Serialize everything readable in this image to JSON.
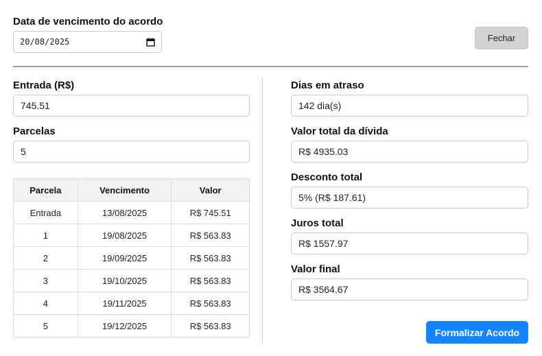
{
  "due_date": {
    "label": "Data de vencimento do acordo",
    "value": "20/08/2025"
  },
  "close_button": "Fechar",
  "left": {
    "entrada_label": "Entrada (R$)",
    "entrada_value": "745.51",
    "parcelas_label": "Parcelas",
    "parcelas_value": "5",
    "table": {
      "headers": [
        "Parcela",
        "Vencimento",
        "Valor"
      ],
      "rows": [
        [
          "Entrada",
          "13/08/2025",
          "R$ 745.51"
        ],
        [
          "1",
          "19/08/2025",
          "R$ 563.83"
        ],
        [
          "2",
          "19/09/2025",
          "R$ 563.83"
        ],
        [
          "3",
          "19/10/2025",
          "R$ 563.83"
        ],
        [
          "4",
          "19/11/2025",
          "R$ 563.83"
        ],
        [
          "5",
          "19/12/2025",
          "R$ 563.83"
        ]
      ]
    }
  },
  "right": {
    "dias_label": "Dias em atraso",
    "dias_value": "142 dia(s)",
    "total_label": "Valor total da dívida",
    "total_value": "R$ 4935.03",
    "desconto_label": "Desconto total",
    "desconto_value": "5% (R$ 187.61)",
    "juros_label": "Juros total",
    "juros_value": "R$ 1557.97",
    "final_label": "Valor final",
    "final_value": "R$ 3564.67"
  },
  "submit_button": "Formalizar Acordo",
  "colors": {
    "primary": "#1485ff",
    "close_bg": "#d3d3d3"
  }
}
